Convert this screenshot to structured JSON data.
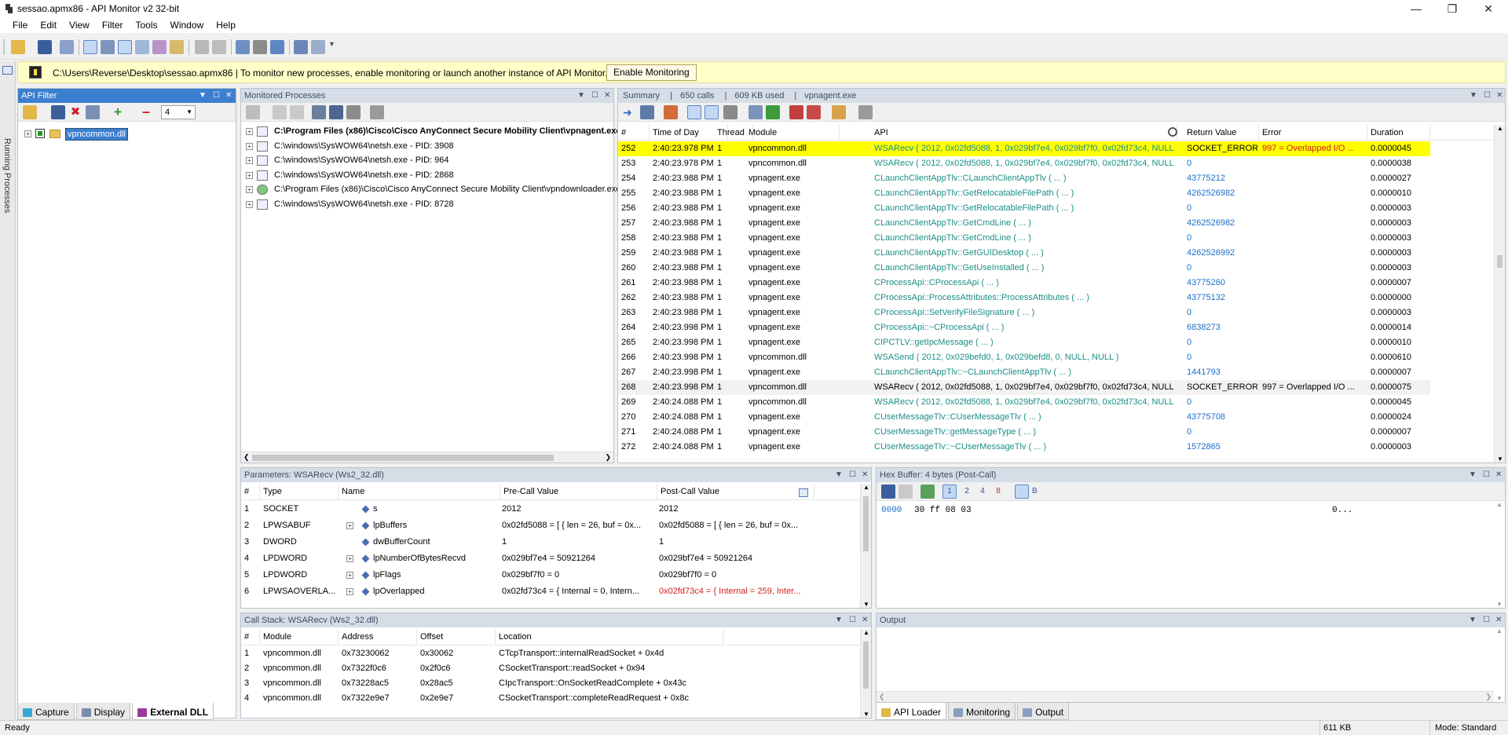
{
  "window": {
    "title": "sessao.apmx86 - API Monitor v2 32-bit"
  },
  "menu": [
    "File",
    "Edit",
    "View",
    "Filter",
    "Tools",
    "Window",
    "Help"
  ],
  "banner": {
    "message": "C:\\Users\\Reverse\\Desktop\\sessao.apmx86  |  To monitor new processes, enable monitoring or launch another instance of API Monitor.",
    "button": "Enable Monitoring"
  },
  "left_strip": {
    "label": "Running Processes"
  },
  "api_filter": {
    "title": "API Filter",
    "combo_value": "4",
    "tree_item": "vpncommon.dll",
    "tabs": [
      "Capture",
      "Display",
      "External DLL"
    ]
  },
  "monitored": {
    "title": "Monitored Processes",
    "items": [
      "C:\\Program Files (x86)\\Cisco\\Cisco AnyConnect Secure Mobility Client\\vpnagent.exe",
      "C:\\windows\\SysWOW64\\netsh.exe - PID: 3908",
      "C:\\windows\\SysWOW64\\netsh.exe - PID: 964",
      "C:\\windows\\SysWOW64\\netsh.exe - PID: 2868",
      "C:\\Program Files (x86)\\Cisco\\Cisco AnyConnect Secure Mobility Client\\vpndownloader.exe",
      "C:\\windows\\SysWOW64\\netsh.exe - PID: 8728"
    ]
  },
  "summary": {
    "title": "Summary",
    "calls": "650 calls",
    "used": "609 KB used",
    "process": "vpnagent.exe",
    "columns": [
      "#",
      "Time of Day",
      "Thread",
      "Module",
      "API",
      "Return Value",
      "Error",
      "Duration"
    ],
    "rows": [
      {
        "n": "252",
        "time": "2:40:23.978 PM",
        "thread": "1",
        "module": "vpncommon.dll",
        "api": "WSARecv ( 2012, 0x02fd5088, 1, 0x029bf7e4, 0x029bf7f0, 0x02fd73c4, NULL )",
        "ret": "SOCKET_ERROR",
        "err": "997 = Overlapped I/O ...",
        "dur": "0.0000045",
        "style": "highlight"
      },
      {
        "n": "253",
        "time": "2:40:23.978 PM",
        "thread": "1",
        "module": "vpncommon.dll",
        "api": "WSARecv ( 2012, 0x02fd5088, 1, 0x029bf7e4, 0x029bf7f0, 0x02fd73c4, NULL )",
        "ret": "0",
        "err": "",
        "dur": "0.0000038",
        "style": "teal"
      },
      {
        "n": "254",
        "time": "2:40:23.988 PM",
        "thread": "1",
        "module": "vpnagent.exe",
        "api": "CLaunchClientAppTlv::CLaunchClientAppTlv ( ... )",
        "ret": "43775212",
        "err": "",
        "dur": "0.0000027",
        "style": "teal"
      },
      {
        "n": "255",
        "time": "2:40:23.988 PM",
        "thread": "1",
        "module": "vpnagent.exe",
        "api": "CLaunchClientAppTlv::GetRelocatableFilePath ( ... )",
        "ret": "4262526982",
        "err": "",
        "dur": "0.0000010",
        "style": "teal"
      },
      {
        "n": "256",
        "time": "2:40:23.988 PM",
        "thread": "1",
        "module": "vpnagent.exe",
        "api": "CLaunchClientAppTlv::GetRelocatableFilePath ( ... )",
        "ret": "0",
        "err": "",
        "dur": "0.0000003",
        "style": "teal"
      },
      {
        "n": "257",
        "time": "2:40:23.988 PM",
        "thread": "1",
        "module": "vpnagent.exe",
        "api": "CLaunchClientAppTlv::GetCmdLine ( ... )",
        "ret": "4262526982",
        "err": "",
        "dur": "0.0000003",
        "style": "teal"
      },
      {
        "n": "258",
        "time": "2:40:23.988 PM",
        "thread": "1",
        "module": "vpnagent.exe",
        "api": "CLaunchClientAppTlv::GetCmdLine ( ... )",
        "ret": "0",
        "err": "",
        "dur": "0.0000003",
        "style": "teal"
      },
      {
        "n": "259",
        "time": "2:40:23.988 PM",
        "thread": "1",
        "module": "vpnagent.exe",
        "api": "CLaunchClientAppTlv::GetGUIDesktop ( ... )",
        "ret": "4262526992",
        "err": "",
        "dur": "0.0000003",
        "style": "teal"
      },
      {
        "n": "260",
        "time": "2:40:23.988 PM",
        "thread": "1",
        "module": "vpnagent.exe",
        "api": "CLaunchClientAppTlv::GetUseInstalled ( ... )",
        "ret": "0",
        "err": "",
        "dur": "0.0000003",
        "style": "teal"
      },
      {
        "n": "261",
        "time": "2:40:23.988 PM",
        "thread": "1",
        "module": "vpnagent.exe",
        "api": "CProcessApi::CProcessApi ( ... )",
        "ret": "43775260",
        "err": "",
        "dur": "0.0000007",
        "style": "teal"
      },
      {
        "n": "262",
        "time": "2:40:23.988 PM",
        "thread": "1",
        "module": "vpnagent.exe",
        "api": "CProcessApi::ProcessAttributes::ProcessAttributes ( ... )",
        "ret": "43775132",
        "err": "",
        "dur": "0.0000000",
        "style": "teal"
      },
      {
        "n": "263",
        "time": "2:40:23.988 PM",
        "thread": "1",
        "module": "vpnagent.exe",
        "api": "CProcessApi::SetVerifyFileSignature ( ... )",
        "ret": "0",
        "err": "",
        "dur": "0.0000003",
        "style": "teal"
      },
      {
        "n": "264",
        "time": "2:40:23.998 PM",
        "thread": "1",
        "module": "vpnagent.exe",
        "api": "CProcessApi::~CProcessApi ( ... )",
        "ret": "6838273",
        "err": "",
        "dur": "0.0000014",
        "style": "teal"
      },
      {
        "n": "265",
        "time": "2:40:23.998 PM",
        "thread": "1",
        "module": "vpnagent.exe",
        "api": "CIPCTLV::getIpcMessage ( ... )",
        "ret": "0",
        "err": "",
        "dur": "0.0000010",
        "style": "teal"
      },
      {
        "n": "266",
        "time": "2:40:23.998 PM",
        "thread": "1",
        "module": "vpncommon.dll",
        "api": "WSASend ( 2012, 0x029befd0, 1, 0x029befd8, 0, NULL, NULL )",
        "ret": "0",
        "err": "",
        "dur": "0.0000610",
        "style": "teal"
      },
      {
        "n": "267",
        "time": "2:40:23.998 PM",
        "thread": "1",
        "module": "vpnagent.exe",
        "api": "CLaunchClientAppTlv::~CLaunchClientAppTlv ( ... )",
        "ret": "1441793",
        "err": "",
        "dur": "0.0000007",
        "style": "teal"
      },
      {
        "n": "268",
        "time": "2:40:23.998 PM",
        "thread": "1",
        "module": "vpncommon.dll",
        "api": "WSARecv ( 2012, 0x02fd5088, 1, 0x029bf7e4, 0x029bf7f0, 0x02fd73c4, NULL )",
        "ret": "SOCKET_ERROR",
        "err": "997 = Overlapped I/O ...",
        "dur": "0.0000075",
        "style": "plain"
      },
      {
        "n": "269",
        "time": "2:40:24.088 PM",
        "thread": "1",
        "module": "vpncommon.dll",
        "api": "WSARecv ( 2012, 0x02fd5088, 1, 0x029bf7e4, 0x029bf7f0, 0x02fd73c4, NULL )",
        "ret": "0",
        "err": "",
        "dur": "0.0000045",
        "style": "teal"
      },
      {
        "n": "270",
        "time": "2:40:24.088 PM",
        "thread": "1",
        "module": "vpnagent.exe",
        "api": "CUserMessageTlv::CUserMessageTlv ( ... )",
        "ret": "43775708",
        "err": "",
        "dur": "0.0000024",
        "style": "teal"
      },
      {
        "n": "271",
        "time": "2:40:24.088 PM",
        "thread": "1",
        "module": "vpnagent.exe",
        "api": "CUserMessageTlv::getMessageType ( ... )",
        "ret": "0",
        "err": "",
        "dur": "0.0000007",
        "style": "teal"
      },
      {
        "n": "272",
        "time": "2:40:24.088 PM",
        "thread": "1",
        "module": "vpnagent.exe",
        "api": "CUserMessageTlv::~CUserMessageTlv ( ... )",
        "ret": "1572865",
        "err": "",
        "dur": "0.0000003",
        "style": "teal"
      }
    ]
  },
  "parameters": {
    "title": "Parameters: WSARecv (Ws2_32.dll)",
    "columns": [
      "#",
      "Type",
      "Name",
      "Pre-Call Value",
      "Post-Call Value"
    ],
    "rows": [
      {
        "n": "1",
        "type": "SOCKET",
        "name": "s",
        "pre": "2012",
        "post": "2012",
        "expand": false,
        "post_red": false
      },
      {
        "n": "2",
        "type": "LPWSABUF",
        "name": "lpBuffers",
        "pre": "0x02fd5088 = [ { len = 26, buf = 0x...",
        "post": "0x02fd5088 = [ { len = 26, buf = 0x...",
        "expand": true,
        "post_red": false
      },
      {
        "n": "3",
        "type": "DWORD",
        "name": "dwBufferCount",
        "pre": "1",
        "post": "1",
        "expand": false,
        "post_red": false
      },
      {
        "n": "4",
        "type": "LPDWORD",
        "name": "lpNumberOfBytesRecvd",
        "pre": "0x029bf7e4 = 50921264",
        "post": "0x029bf7e4 = 50921264",
        "expand": true,
        "post_red": false
      },
      {
        "n": "5",
        "type": "LPDWORD",
        "name": "lpFlags",
        "pre": "0x029bf7f0 = 0",
        "post": "0x029bf7f0 = 0",
        "expand": true,
        "post_red": false
      },
      {
        "n": "6",
        "type": "LPWSAOVERLA...",
        "name": "lpOverlapped",
        "pre": "0x02fd73c4 = { Internal = 0, Intern...",
        "post": "0x02fd73c4 = { Internal = 259, Inter...",
        "expand": true,
        "post_red": true
      }
    ]
  },
  "hex": {
    "title": "Hex Buffer: 4 bytes (Post-Call)",
    "offset": "0000",
    "bytes": "30 ff 08 03",
    "ascii": "0..."
  },
  "callstack": {
    "title": "Call Stack: WSARecv (Ws2_32.dll)",
    "columns": [
      "#",
      "Module",
      "Address",
      "Offset",
      "Location"
    ],
    "rows": [
      {
        "n": "1",
        "module": "vpncommon.dll",
        "address": "0x73230062",
        "offset": "0x30062",
        "location": "CTcpTransport::internalReadSocket + 0x4d"
      },
      {
        "n": "2",
        "module": "vpncommon.dll",
        "address": "0x7322f0c6",
        "offset": "0x2f0c6",
        "location": "CSocketTransport::readSocket + 0x94"
      },
      {
        "n": "3",
        "module": "vpncommon.dll",
        "address": "0x73228ac5",
        "offset": "0x28ac5",
        "location": "CIpcTransport::OnSocketReadComplete + 0x43c"
      },
      {
        "n": "4",
        "module": "vpncommon.dll",
        "address": "0x7322e9e7",
        "offset": "0x2e9e7",
        "location": "CSocketTransport::completeReadRequest + 0x8c"
      }
    ]
  },
  "output": {
    "title": "Output",
    "tabs": [
      "API Loader",
      "Monitoring",
      "Output"
    ]
  },
  "statusbar": {
    "left": "Ready",
    "mem": "611 KB",
    "mode": "Mode: Standard"
  },
  "colors": {
    "highlight": "#ffff00",
    "accent": "#3c7fd0",
    "teal": "#1b8f86",
    "blue": "#1a6fc9",
    "red": "#d21e1e"
  }
}
